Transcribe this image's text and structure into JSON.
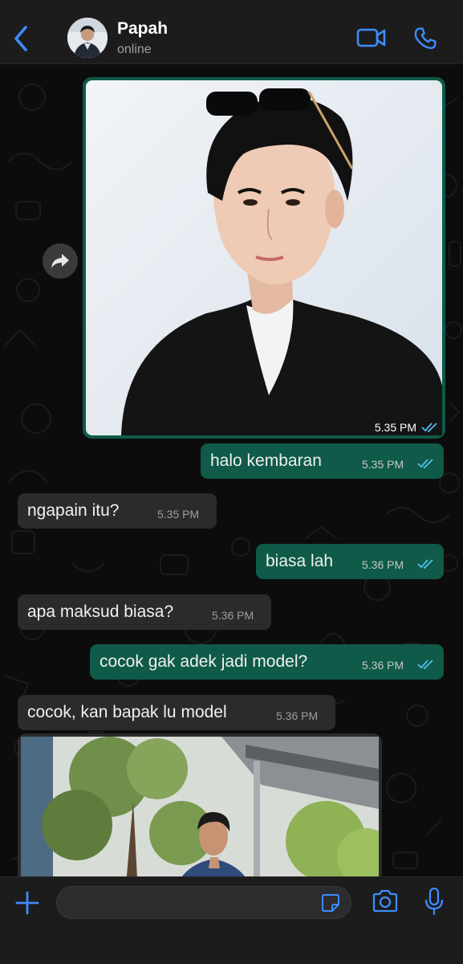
{
  "contact": {
    "name": "Papah",
    "status": "online"
  },
  "messages": [
    {
      "direction": "out",
      "type": "image",
      "time": "5.35 PM",
      "read": true
    },
    {
      "direction": "out",
      "text": "halo kembaran",
      "time": "5.35 PM",
      "read": true
    },
    {
      "direction": "in",
      "text": "ngapain itu?",
      "time": "5.35 PM"
    },
    {
      "direction": "out",
      "text": "biasa lah",
      "time": "5.36 PM",
      "read": true
    },
    {
      "direction": "in",
      "text": "apa maksud biasa?",
      "time": "5.36 PM"
    },
    {
      "direction": "out",
      "text": "cocok gak adek jadi model?",
      "time": "5.36 PM",
      "read": true
    },
    {
      "direction": "in",
      "text": "cocok, kan bapak lu model",
      "time": "5.36 PM"
    },
    {
      "direction": "in",
      "type": "image"
    }
  ],
  "composer": {
    "value": ""
  },
  "icons": {
    "back": "chevron-left-icon",
    "video": "video-call-icon",
    "call": "phone-icon",
    "forward": "forward-icon",
    "plus": "plus-icon",
    "sticker": "sticker-icon",
    "camera": "camera-icon",
    "mic": "microphone-icon"
  },
  "colors": {
    "accent": "#3d8bfd",
    "outgoing_bubble": "#0f5a48",
    "incoming_bubble": "#2b2b2d",
    "read_ticks": "#53bdeb"
  }
}
